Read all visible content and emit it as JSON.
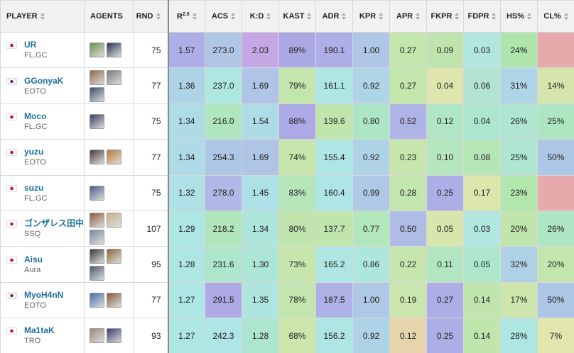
{
  "headers": {
    "player": "PLAYER",
    "agents": "AGENTS",
    "rnd": "RND",
    "rating": "R",
    "rating_sup": "2.0",
    "acs": "ACS",
    "kd": "K:D",
    "kast": "KAST",
    "adr": "ADR",
    "kpr": "KPR",
    "apr": "APR",
    "fkpr": "FKPR",
    "fdpr": "FDPR",
    "hs": "HS%",
    "cl": "CL%"
  },
  "icons": {
    "sort": "sort-arrows-icon",
    "flag_jp": "japan-flag-icon",
    "flag_kr": "south-korea-flag-icon"
  },
  "rows": [
    {
      "name": "UR",
      "team": "FL.GC",
      "flag": "jp",
      "agents": [
        "#6a8f4e",
        "#2c3559"
      ],
      "rnd": "75",
      "stats": [
        "1.57",
        "273.0",
        "2.03",
        "89%",
        "190.1",
        "1.00",
        "0.27",
        "0.09",
        "0.03",
        "24%",
        ""
      ],
      "colors": [
        "#aeaee6",
        "#afc6e4",
        "#c6a7e6",
        "#aba9e4",
        "#aeaee6",
        "#aec7e6",
        "#c3e6ad",
        "#bfe4ad",
        "#b1e6e1",
        "#aee5ad",
        "#e8a9ad"
      ]
    },
    {
      "name": "GGonyaK",
      "team": "EOTO",
      "flag": "kr",
      "agents": [
        "#8e6a4c",
        "#7a7d74",
        "#3e4f6a"
      ],
      "rnd": "77",
      "stats": [
        "1.36",
        "237.0",
        "1.69",
        "79%",
        "161.1",
        "0.92",
        "0.27",
        "0.04",
        "0.06",
        "31%",
        "14%"
      ],
      "colors": [
        "#aed2e6",
        "#aee6e0",
        "#afc4e6",
        "#c2e6ad",
        "#aee6e4",
        "#afd4e6",
        "#c3e6ad",
        "#dfe6ad",
        "#b2e3d4",
        "#aed6e6",
        "#d4e6ad"
      ]
    },
    {
      "name": "Moco",
      "team": "FL.GC",
      "flag": "jp",
      "agents": [
        "#3b4266"
      ],
      "rnd": "75",
      "stats": [
        "1.34",
        "216.0",
        "1.54",
        "88%",
        "139.6",
        "0.80",
        "0.52",
        "0.12",
        "0.04",
        "26%",
        "25%"
      ],
      "colors": [
        "#aedbe6",
        "#b0e6bf",
        "#aedce6",
        "#abaae6",
        "#c0e6ad",
        "#ade6c5",
        "#aeb4e6",
        "#b0e6c4",
        "#ade6ce",
        "#aee6d1",
        "#aee6c2"
      ]
    },
    {
      "name": "yuzu",
      "team": "EOTO",
      "flag": "jp",
      "agents": [
        "#4a3a3e",
        "#b87a36"
      ],
      "rnd": "77",
      "stats": [
        "1.34",
        "254.3",
        "1.69",
        "74%",
        "155.4",
        "0.92",
        "0.23",
        "0.10",
        "0.08",
        "25%",
        "50%"
      ],
      "colors": [
        "#aedbe6",
        "#aec6e6",
        "#afc5e6",
        "#c6e6ad",
        "#aee6e4",
        "#afd3e6",
        "#c6e6ad",
        "#b5e6bd",
        "#b5e6b6",
        "#aee6d1",
        "#aec6e6"
      ]
    },
    {
      "name": "suzu",
      "team": "FL.GC",
      "flag": "jp",
      "agents": [
        "#4a5a8e"
      ],
      "rnd": "75",
      "stats": [
        "1.32",
        "278.0",
        "1.45",
        "83%",
        "160.4",
        "0.99",
        "0.28",
        "0.25",
        "0.17",
        "23%",
        ""
      ],
      "colors": [
        "#aee0e6",
        "#afb8e6",
        "#aee1e6",
        "#b5e6ba",
        "#aee6e6",
        "#aec8e6",
        "#c2e6ad",
        "#aeaee6",
        "#dde6ad",
        "#b1e6ad",
        "#e8a9ad"
      ]
    },
    {
      "name": "ゴンザレス田中",
      "team": "SSQ",
      "flag": "jp",
      "agents": [
        "#8e5a3e",
        "#c9b08a",
        "#7b8aa0"
      ],
      "rnd": "107",
      "stats": [
        "1.29",
        "218.2",
        "1.34",
        "80%",
        "137.7",
        "0.77",
        "0.50",
        "0.05",
        "0.03",
        "20%",
        "26%"
      ],
      "colors": [
        "#aee6e4",
        "#b1e6bd",
        "#aee6dc",
        "#c0e6ad",
        "#c1e6ad",
        "#b4e6bc",
        "#aebce6",
        "#d6e6ad",
        "#b1e6e1",
        "#c1e6ad",
        "#aee6c4"
      ]
    },
    {
      "name": "Aisu",
      "team": "Aura",
      "flag": "jp",
      "agents": [
        "#3b3b3b",
        "#8a6a3a",
        "#4e5a6a"
      ],
      "rnd": "95",
      "stats": [
        "1.28",
        "231.6",
        "1.30",
        "73%",
        "165.2",
        "0.86",
        "0.22",
        "0.11",
        "0.05",
        "32%",
        "20%"
      ],
      "colors": [
        "#aee6e4",
        "#ade6ca",
        "#ade6d6",
        "#c7e6ad",
        "#ade6e2",
        "#ade6dc",
        "#c7e6ad",
        "#b2e6c0",
        "#ade6cb",
        "#aed1e6",
        "#c3e6ad"
      ]
    },
    {
      "name": "MyoH4nN",
      "team": "EOTO",
      "flag": "kr",
      "agents": [
        "#4a6aa8",
        "#8a5a3a"
      ],
      "rnd": "77",
      "stats": [
        "1.27",
        "291.5",
        "1.35",
        "78%",
        "187.5",
        "1.00",
        "0.19",
        "0.27",
        "0.14",
        "17%",
        "50%"
      ],
      "colors": [
        "#aee6e4",
        "#afa9e6",
        "#aee6df",
        "#c2e6ad",
        "#adb1e6",
        "#aec8e6",
        "#cbe6ad",
        "#aeaee6",
        "#c0e6ad",
        "#cde6ad",
        "#aec6e6"
      ]
    },
    {
      "name": "Ma1taK",
      "team": "TRO",
      "flag": "jp",
      "agents": [
        "#9a8a7a",
        "#3a3a6a"
      ],
      "rnd": "93",
      "stats": [
        "1.27",
        "242.3",
        "1.28",
        "68%",
        "156.2",
        "0.92",
        "0.12",
        "0.25",
        "0.14",
        "28%",
        "7%"
      ],
      "colors": [
        "#aee6e4",
        "#aee6e6",
        "#ade6cf",
        "#cde6ad",
        "#aee6e4",
        "#afd3e6",
        "#e6d4ad",
        "#aeaee6",
        "#c0e6ad",
        "#aee6e1",
        "#e1e6ad"
      ]
    }
  ]
}
